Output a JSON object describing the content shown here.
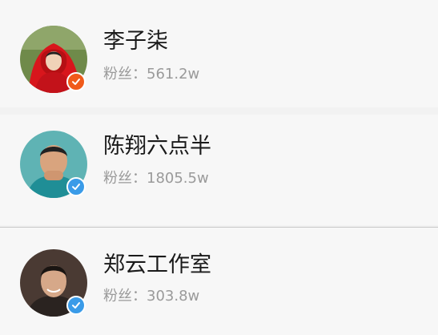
{
  "users": [
    {
      "name": "李子柒",
      "fans_label": "粉丝：",
      "fans_count": "561.2w",
      "avatar_icon": "avatar-red-hood-photo",
      "verify_icon": "checkmark-icon",
      "verify_color": "#f05a1a"
    },
    {
      "name": "陈翔六点半",
      "fans_label": "粉丝：",
      "fans_count": "1805.5w",
      "avatar_icon": "avatar-man-photo",
      "verify_icon": "checkmark-icon",
      "verify_color": "#3a9be8"
    },
    {
      "name": "郑云工作室",
      "fans_label": "粉丝：",
      "fans_count": "303.8w",
      "avatar_icon": "avatar-smiling-man-photo",
      "verify_icon": "checkmark-icon",
      "verify_color": "#3a9be8"
    }
  ]
}
